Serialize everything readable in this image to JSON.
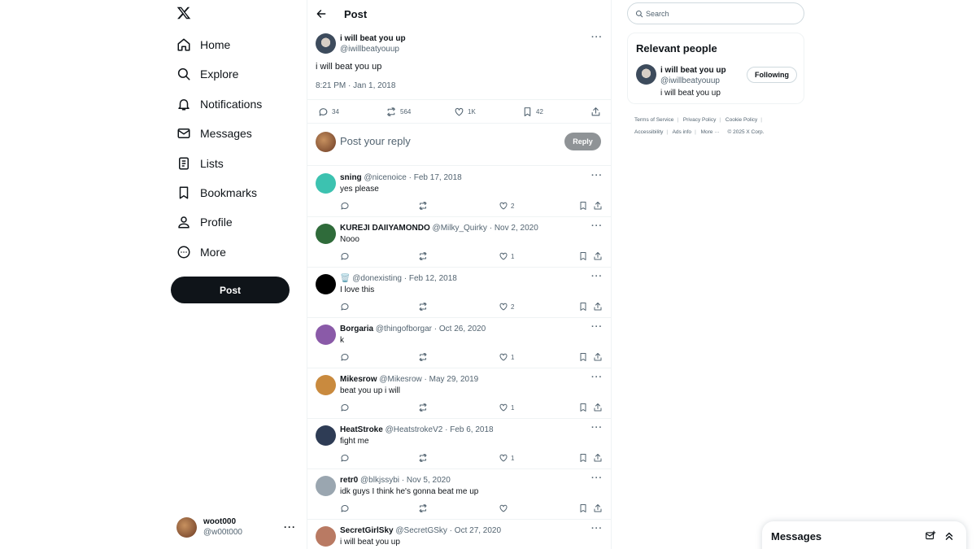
{
  "sidebar": {
    "logo": "x-logo-icon",
    "nav": [
      {
        "label": "Home",
        "icon": "home-icon"
      },
      {
        "label": "Explore",
        "icon": "search-icon"
      },
      {
        "label": "Notifications",
        "icon": "bell-icon"
      },
      {
        "label": "Messages",
        "icon": "envelope-icon"
      },
      {
        "label": "Lists",
        "icon": "list-icon"
      },
      {
        "label": "Bookmarks",
        "icon": "bookmark-icon"
      },
      {
        "label": "Profile",
        "icon": "person-icon"
      },
      {
        "label": "More",
        "icon": "more-circle-icon"
      }
    ],
    "post_button": "Post",
    "account": {
      "name": "woot000",
      "handle": "@w00t000"
    }
  },
  "header": {
    "title": "Post"
  },
  "post": {
    "name": "i will beat you up",
    "handle": "@iwillbeatyouup",
    "text": "i will beat you up",
    "timestamp": "8:21 PM · Jan 1, 2018",
    "stats": {
      "replies": "34",
      "reposts": "564",
      "likes": "1K",
      "bookmarks": "42"
    }
  },
  "reply_box": {
    "placeholder": "Post your reply",
    "button": "Reply"
  },
  "replies": [
    {
      "name": "sning",
      "handle": "@nicenoice",
      "date": "Feb 17, 2018",
      "text": "yes please",
      "likes": "2",
      "avatar_color": "#3cc2b0"
    },
    {
      "name": "KUREJI DAIIYAMONDO",
      "handle": "@Milky_Quirky",
      "date": "Nov 2, 2020",
      "text": "Nooo",
      "likes": "1",
      "avatar_color": "#2f6b3a"
    },
    {
      "name": "🗑️",
      "handle": "@donexisting",
      "date": "Feb 12, 2018",
      "text": "I love this",
      "likes": "2",
      "avatar_color": "#000000"
    },
    {
      "name": "Borgaria",
      "handle": "@thingofborgar",
      "date": "Oct 26, 2020",
      "text": "k",
      "likes": "1",
      "avatar_color": "#8a5aa8"
    },
    {
      "name": "Mikesrow",
      "handle": "@Mikesrow",
      "date": "May 29, 2019",
      "text": "beat you up i will",
      "likes": "1",
      "avatar_color": "#c98a3e"
    },
    {
      "name": "HeatStroke",
      "handle": "@HeatstrokeV2",
      "date": "Feb 6, 2018",
      "text": "fight me",
      "likes": "1",
      "avatar_color": "#2e3c55"
    },
    {
      "name": "retr0",
      "handle": "@blkjssybi",
      "date": "Nov 5, 2020",
      "text": "idk guys I think he's gonna beat me up",
      "likes": "",
      "avatar_color": "#9aa6b0"
    },
    {
      "name": "SecretGirlSky",
      "handle": "@SecretGSky",
      "date": "Oct 27, 2020",
      "text": "i will beat you up",
      "likes": "",
      "avatar_color": "#b97a63"
    }
  ],
  "right": {
    "search_placeholder": "Search",
    "relevant_title": "Relevant people",
    "person": {
      "name": "i will beat you up",
      "handle": "@iwillbeatyouup",
      "bio": "i will beat you up",
      "button": "Following"
    },
    "footer": {
      "terms": "Terms of Service",
      "privacy": "Privacy Policy",
      "cookie": "Cookie Policy",
      "accessibility": "Accessibility",
      "ads": "Ads info",
      "more": "More ···",
      "copyright": "© 2025 X Corp."
    }
  },
  "messages_drawer": {
    "title": "Messages"
  },
  "colors": {
    "text": "#0f1419",
    "secondary": "#536471",
    "border": "#eff3f4"
  }
}
